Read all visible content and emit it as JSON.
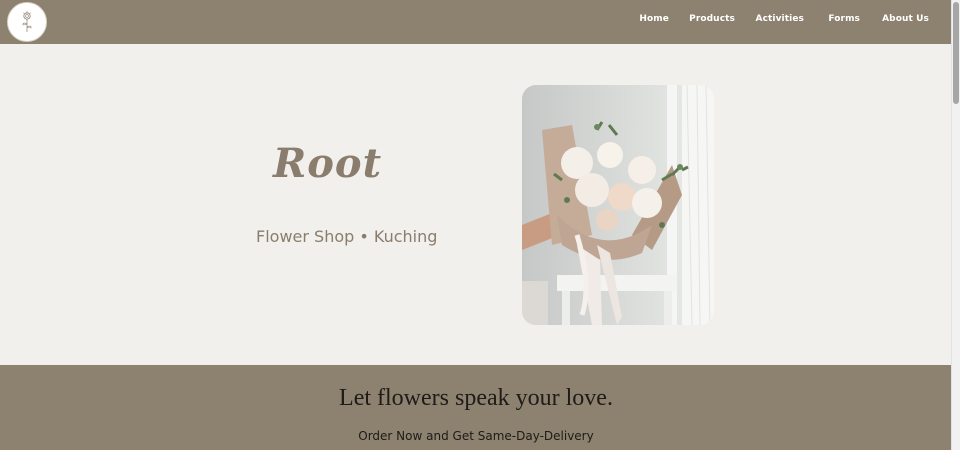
{
  "nav": {
    "logo_icon": "flower-sketch-icon",
    "links": [
      "Home",
      "Products",
      "Activities",
      "Forms",
      "About Us"
    ]
  },
  "hero": {
    "brand": "Root",
    "tagline": "Flower Shop • Kuching",
    "photo": "bouquet-of-white-roses-image"
  },
  "band": {
    "headline": "Let flowers speak your love.",
    "subtext": "Order Now and Get Same-Day-Delivery"
  },
  "colors": {
    "nav_bg": "#8d8170",
    "hero_bg": "#f2f0ec",
    "accent_text": "#8a7d6d"
  }
}
